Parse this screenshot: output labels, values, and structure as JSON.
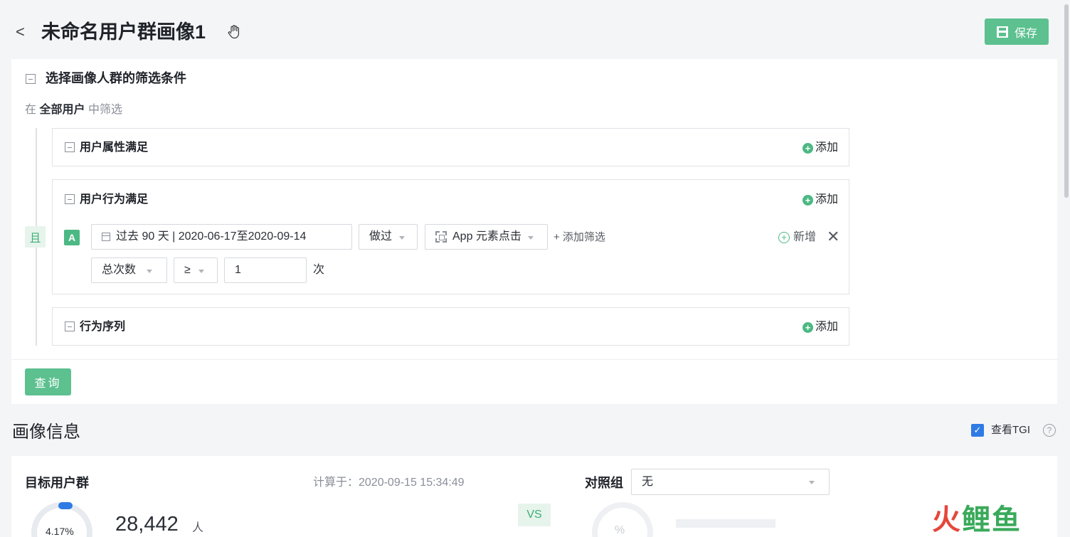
{
  "header": {
    "back_glyph": "<",
    "title": "未命名用户群画像1",
    "save_label": "保存"
  },
  "filter": {
    "section_title": "选择画像人群的筛选条件",
    "scope_prefix": "在",
    "scope_value": "全部用户",
    "scope_suffix": "中筛选",
    "and_label": "且",
    "add_label": "添加",
    "groups": {
      "attribute": {
        "label": "用户属性满足"
      },
      "behavior": {
        "label": "用户行为满足"
      },
      "sequence": {
        "label": "行为序列"
      }
    },
    "rule": {
      "badge": "A",
      "date_range": "过去 90 天 | 2020-06-17至2020-09-14",
      "action": "做过",
      "event": "App 元素点击",
      "add_filter": "+ 添加筛选",
      "new_label": "新增",
      "close_glyph": "✕",
      "metric": "总次数",
      "operator": "≥",
      "threshold": "1",
      "unit": "次"
    },
    "query_label": "查询"
  },
  "portrait": {
    "title": "画像信息",
    "tgi_label": "查看TGI",
    "tgi_checked": true,
    "help_glyph": "?",
    "target_label": "目标用户群",
    "calc_time": "计算于：2020-09-15 15:34:49",
    "ratio": "4.17%",
    "count": "28,442",
    "count_unit": "人",
    "vs_label": "VS",
    "compare_label": "对照组",
    "compare_value": "无",
    "compare_ratio": "%"
  },
  "watermark": {
    "part1": "火",
    "part2": "鲤鱼"
  },
  "colors": {
    "brand_green": "#5cc08f",
    "check_blue": "#2f7be5",
    "background": "#f4f5f7"
  },
  "icons": [
    "chevron-left-icon",
    "hand-cursor-icon",
    "save-icon",
    "collapse-icon",
    "plus-circle-icon",
    "calendar-icon",
    "focus-icon",
    "caret-down-icon",
    "close-icon",
    "checkbox-icon",
    "help-icon"
  ]
}
